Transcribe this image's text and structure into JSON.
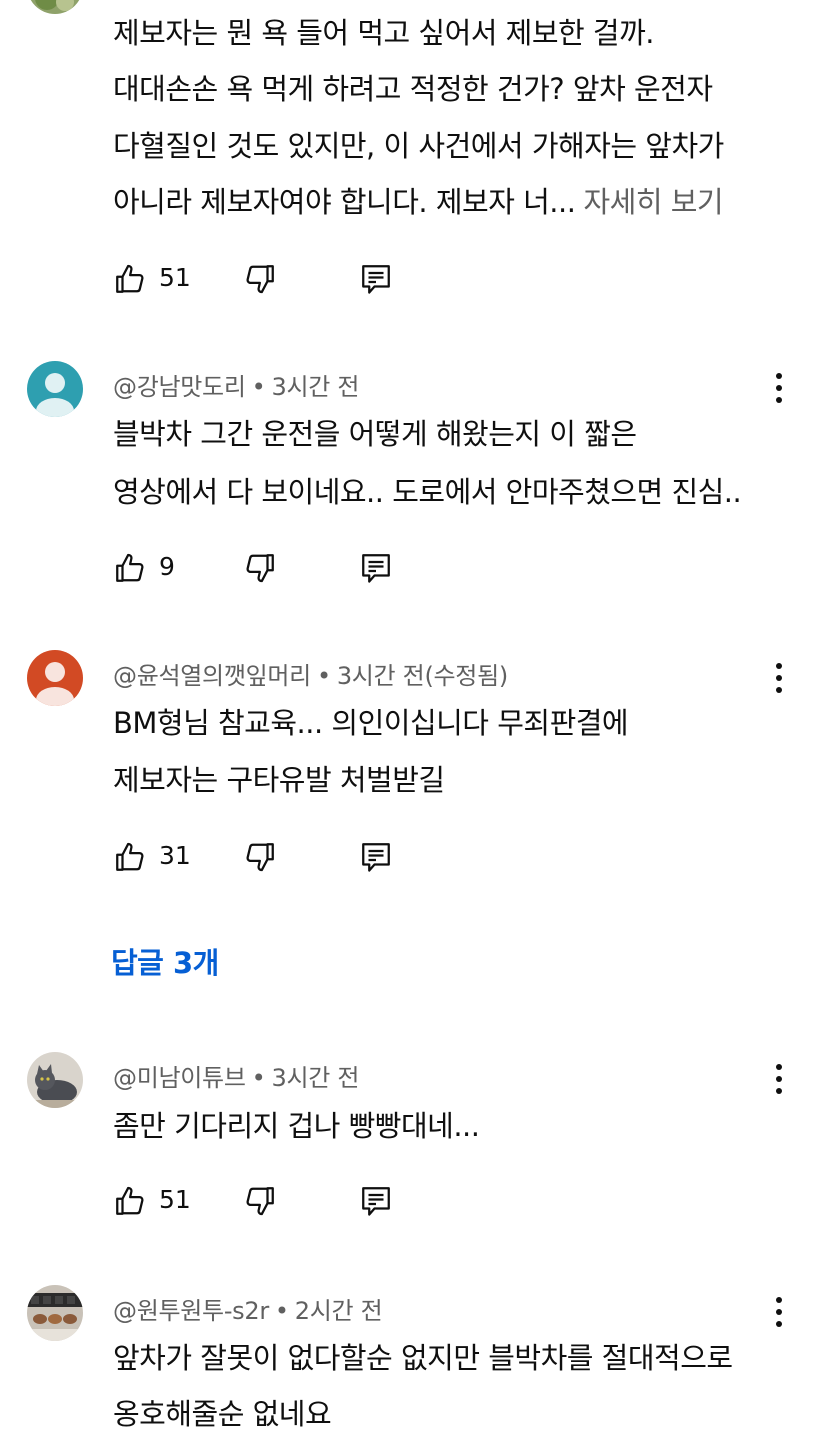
{
  "comments": [
    {
      "lines": [
        "제보자는 뭔 욕 들어 먹고 싶어서 제보한 걸까.",
        "대대손손 욕 먹게 하려고 적정한 건가? 앞차 운전자",
        "다혈질인 것도 있지만, 이 사건에서 가해자는 앞차가",
        "아니라 제보자여야 합니다. 제보자 너..."
      ],
      "more_label": "자세히 보기",
      "likes": "51"
    },
    {
      "author": "@강남맛도리",
      "time": "3시간 전",
      "avatar_color": "#2e9fb0",
      "lines": [
        "블박차 그간 운전을 어떻게 해왔는지 이 짧은",
        "영상에서 다 보이네요.. 도로에서 안마주쳤으면 진심.."
      ],
      "likes": "9"
    },
    {
      "author": "@윤석열의깻잎머리",
      "time": "3시간 전(수정됨)",
      "avatar_color": "#d24a24",
      "lines": [
        "BM형님 참교육... 의인이십니다 무죄판결에",
        "제보자는 구타유발 처벌받길"
      ],
      "likes": "31",
      "replies_label": "답글 3개"
    },
    {
      "author": "@미남이튜브",
      "time": "3시간 전",
      "lines": [
        "좀만 기다리지 겁나 빵빵대네..."
      ],
      "likes": "51"
    },
    {
      "author": "@원투원투-s2r",
      "time": "2시간 전",
      "lines": [
        "앞차가 잘못이 없다할순 없지만 블박차를 절대적으로",
        "옹호해줄순 없네요"
      ]
    }
  ],
  "meta_separator": "•",
  "icons": {
    "like": "thumbs-up-icon",
    "dislike": "thumbs-down-icon",
    "reply": "reply-comment-icon",
    "menu": "more-vertical-icon"
  }
}
